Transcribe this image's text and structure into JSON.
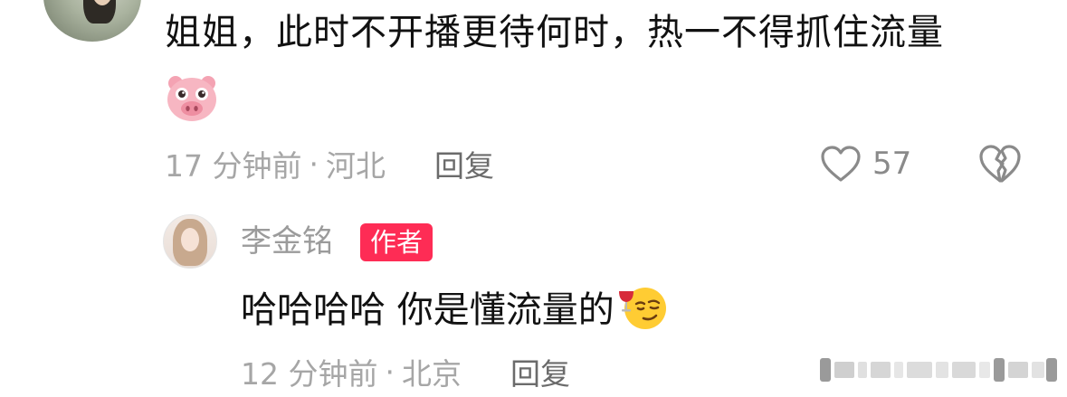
{
  "comment": {
    "text": "姐姐，此时不开播更待何时，热一不得抓住流量",
    "emoji_icon": "pig-face-emoji",
    "time": "17 分钟前",
    "separator": "·",
    "location": "河北",
    "reply_label": "回复",
    "like_count": "57",
    "like_icon": "heart-outline-icon",
    "dislike_icon": "broken-heart-icon"
  },
  "reply": {
    "author": "李金铭",
    "badge": "作者",
    "badge_color": "#fe2c55",
    "text": "哈哈哈哈 你是懂流量的",
    "emoji_icon": "wine-smirk-emoji",
    "time": "12 分钟前",
    "separator": "·",
    "location": "北京",
    "reply_label": "回复"
  },
  "watermark_icon": "watermark-bars"
}
